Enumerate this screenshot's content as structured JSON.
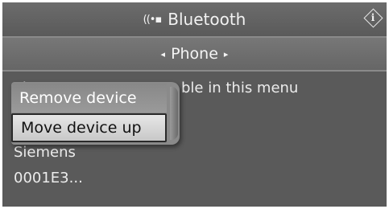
{
  "header": {
    "title": "Bluetooth",
    "bt_symbol": "((•▪",
    "info_letter": "i"
  },
  "subheader": {
    "label": "Phone",
    "left_arrow": "◂",
    "right_arrow": "▸"
  },
  "content": {
    "message_fragment": "ble in this menu",
    "message_line_start": "Ph",
    "device_name": "Siemens",
    "device_address": "0001E3..."
  },
  "context_menu": {
    "items": [
      {
        "label": "Remove device",
        "selected": false
      },
      {
        "label": "Move device up",
        "selected": true
      }
    ]
  }
}
